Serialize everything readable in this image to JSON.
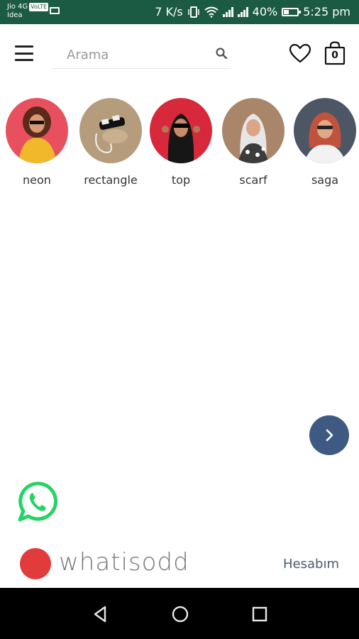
{
  "status_bar": {
    "carrier1": "Jio 4G",
    "badge": "VoLTE",
    "carrier2": "Idea",
    "speed": "7 K/s",
    "battery": "40%",
    "battery_level": 0.4,
    "time": "5:25 pm"
  },
  "header": {
    "search_placeholder": "Arama",
    "cart_count": "0"
  },
  "stories": [
    {
      "label": "neon",
      "bg": "#e8505f"
    },
    {
      "label": "rectangle",
      "bg": "#b59c7c"
    },
    {
      "label": "top",
      "bg": "#d8283c"
    },
    {
      "label": "scarf",
      "bg": "#a9856a"
    },
    {
      "label": "saga",
      "bg": "#4c5665"
    }
  ],
  "footer": {
    "brand": "whatisodd",
    "account": "Hesabım"
  },
  "colors": {
    "status_bar": "#1c5b43",
    "next_button": "#3f5a82",
    "brand_dot": "#e23b3b",
    "whatsapp": "#25d366"
  }
}
